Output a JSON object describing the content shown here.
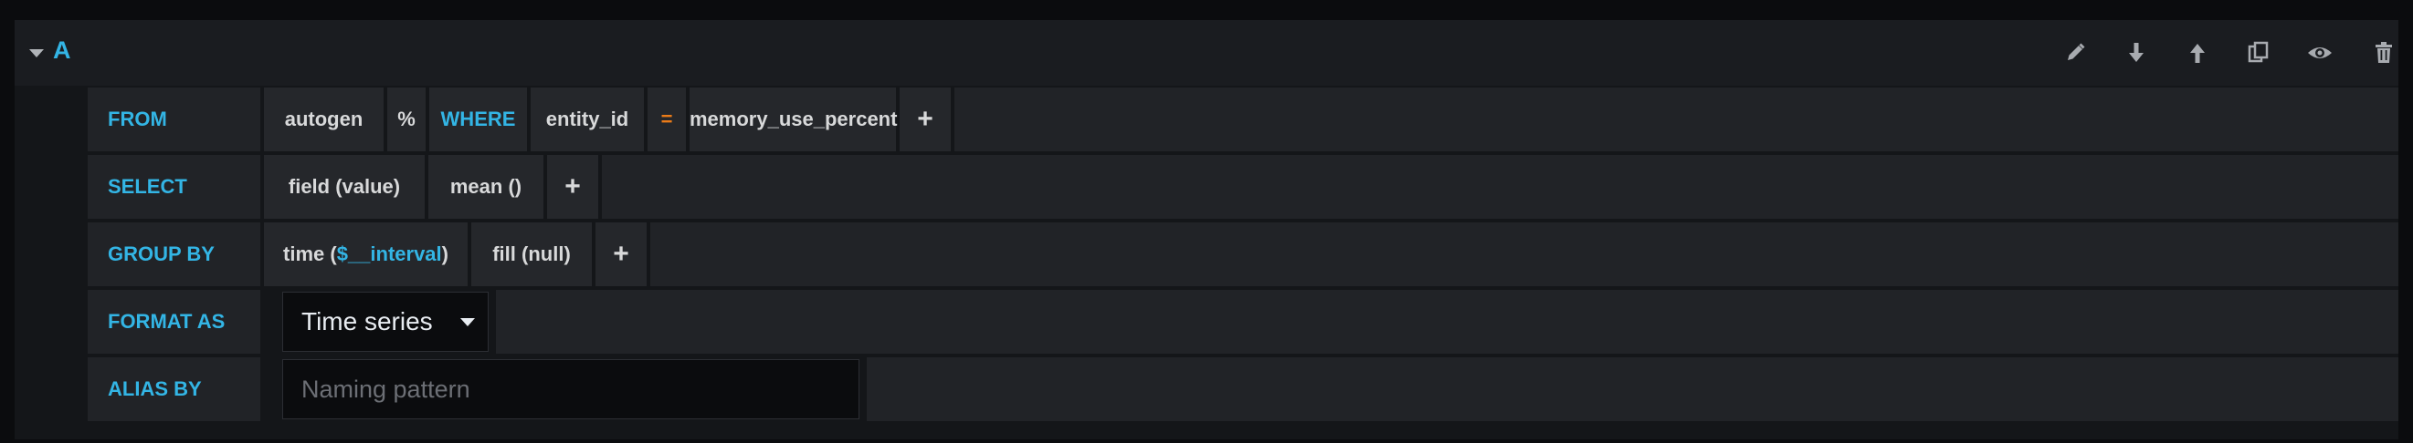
{
  "query": {
    "ref_id": "A"
  },
  "toolbar": {
    "icons": [
      "pencil-icon",
      "arrow-down-icon",
      "arrow-up-icon",
      "duplicate-icon",
      "eye-icon",
      "trash-icon"
    ]
  },
  "from_row": {
    "label": "FROM",
    "policy": "autogen",
    "measurement": "%",
    "where_label": "WHERE",
    "tag_key": "entity_id",
    "operator": "=",
    "tag_value": "memory_use_percent",
    "add": "+"
  },
  "select_row": {
    "label": "SELECT",
    "field": "field (value)",
    "aggregation": "mean ()",
    "add": "+"
  },
  "group_row": {
    "label": "GROUP BY",
    "time_prefix": "time (",
    "time_interval": "$__interval",
    "time_suffix": ")",
    "fill": "fill (null)",
    "add": "+"
  },
  "format_row": {
    "label": "FORMAT AS",
    "selected": "Time series"
  },
  "alias_row": {
    "label": "ALIAS BY",
    "value": "",
    "placeholder": "Naming pattern"
  },
  "colors": {
    "accent": "#33b5e5",
    "operator": "#eb7b18",
    "background": "#0b0c0e",
    "segment": "#25272b",
    "label_bg": "#212327",
    "text": "#d8d9da"
  }
}
